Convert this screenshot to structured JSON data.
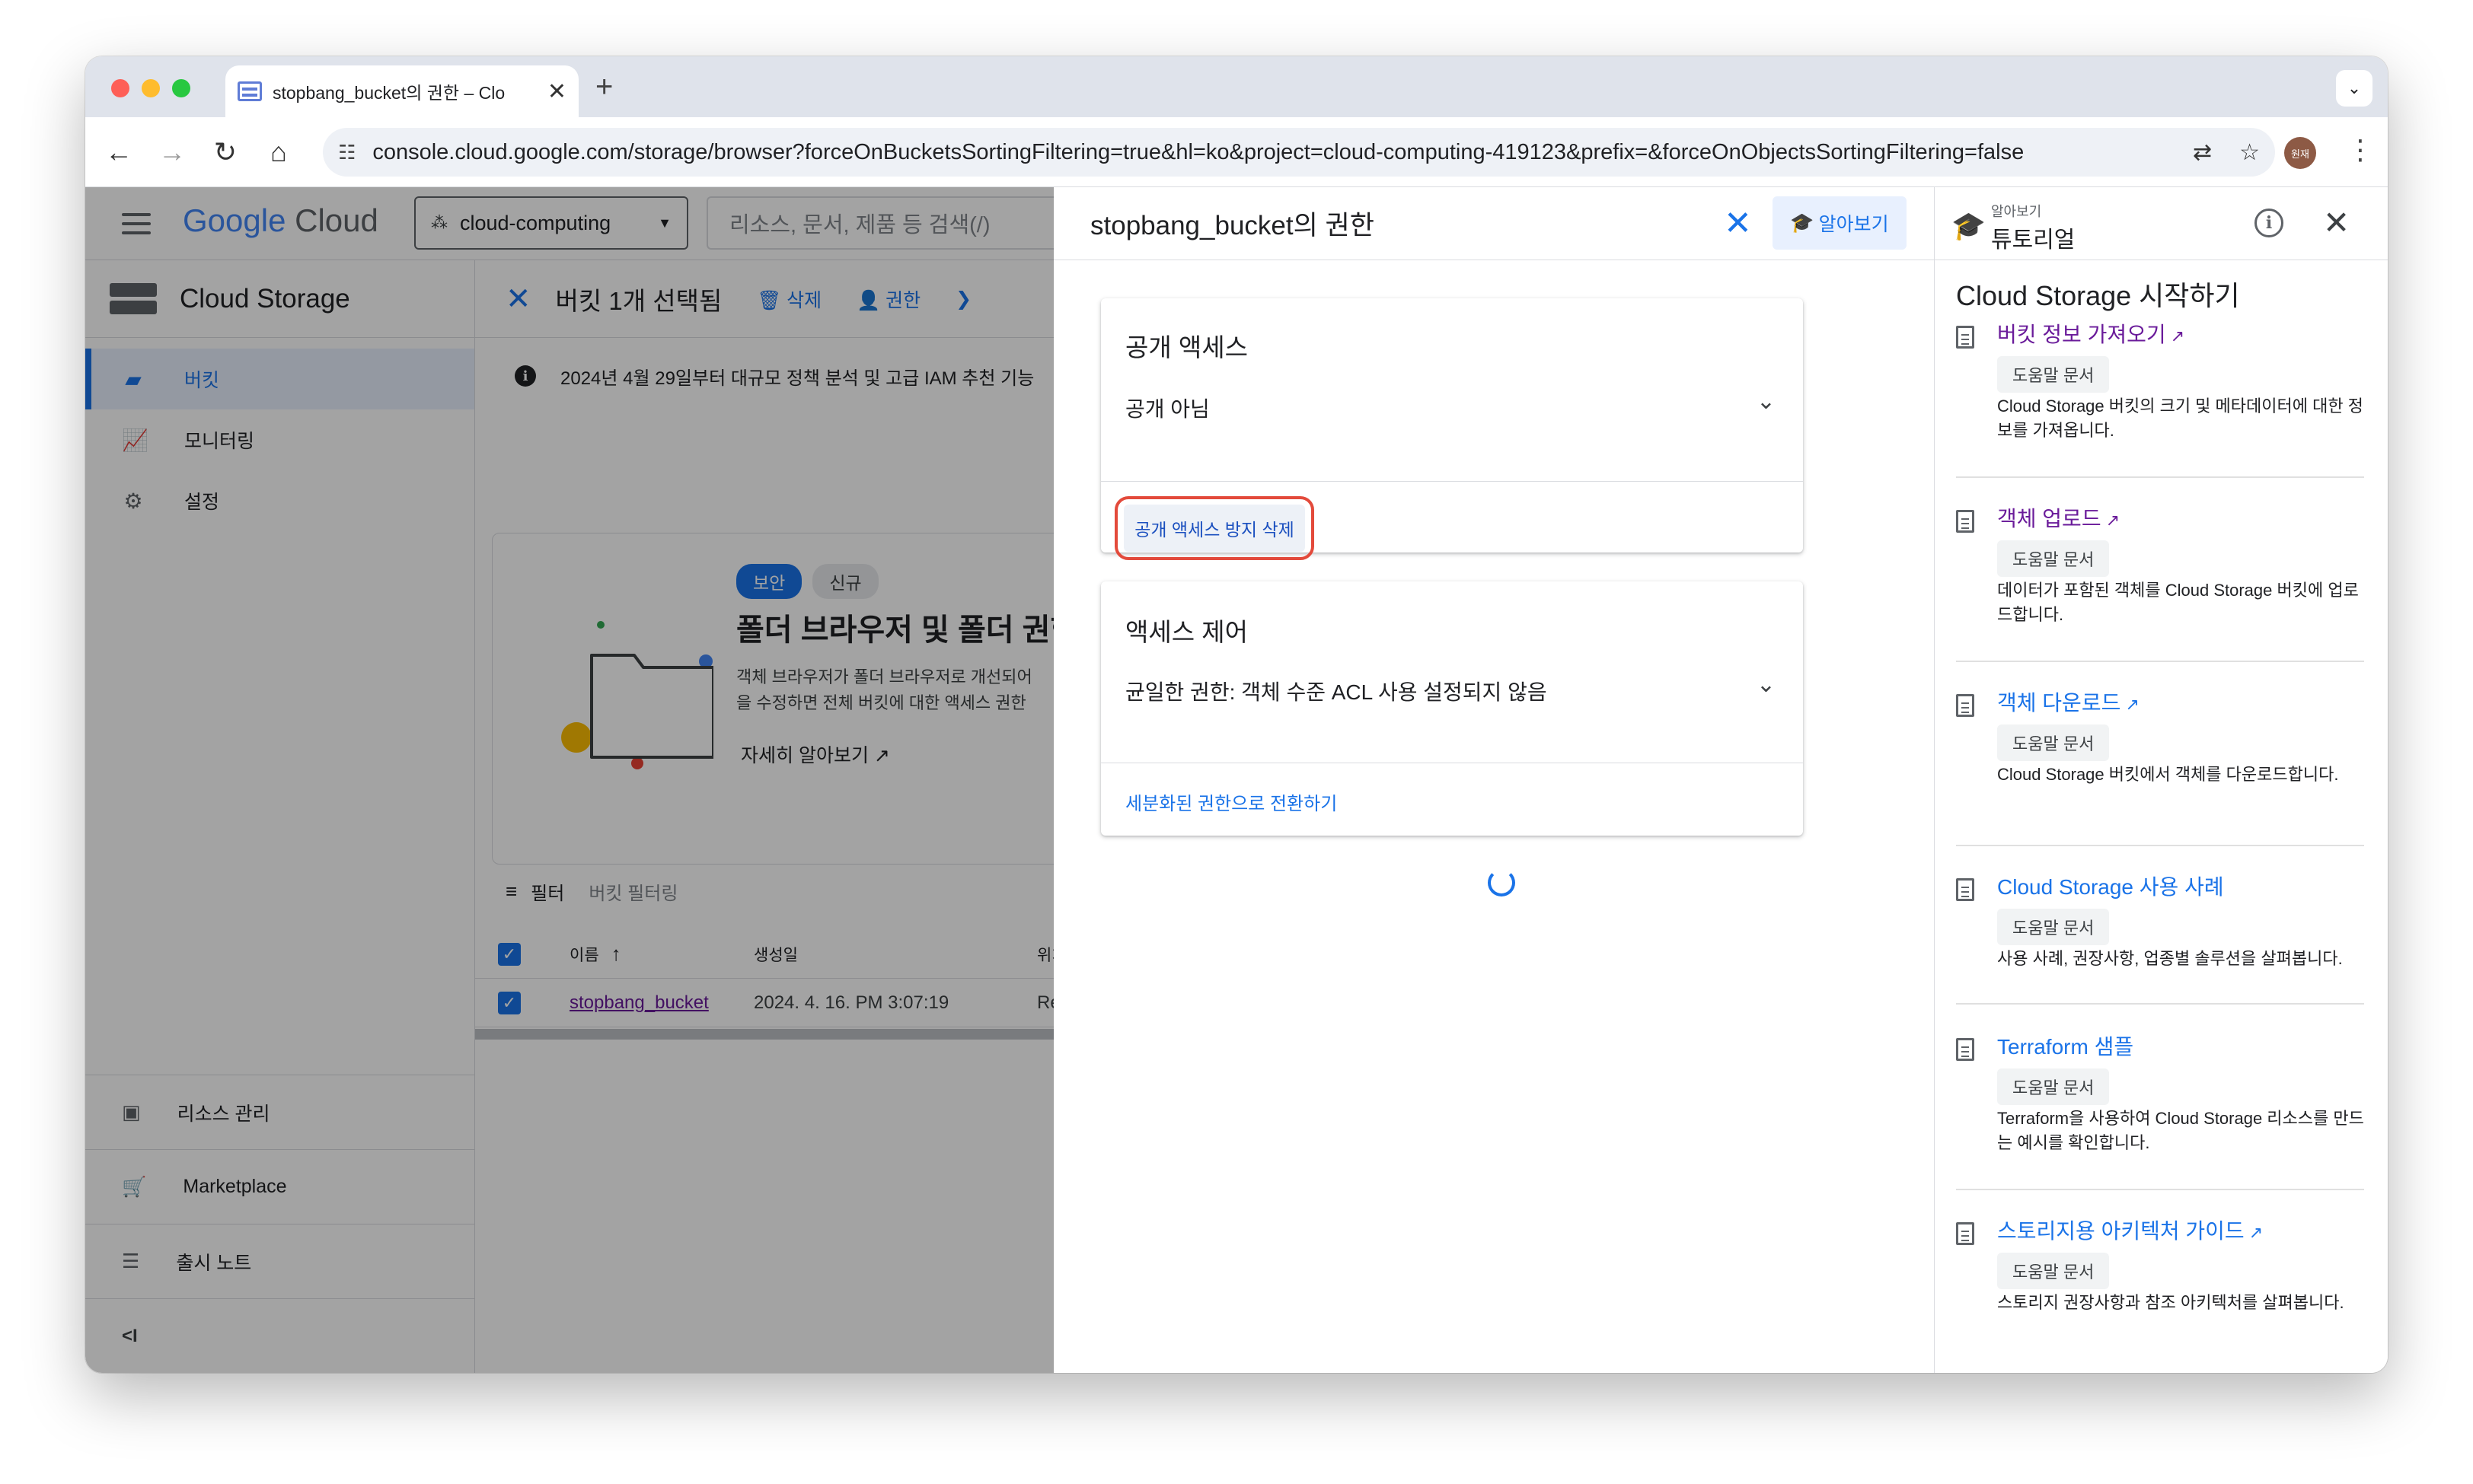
{
  "browser": {
    "tab_title": "stopbang_bucket의 권한 – Clo",
    "url": "console.cloud.google.com/storage/browser?forceOnBucketsSortingFiltering=true&hl=ko&project=cloud-computing-419123&prefix=&forceOnObjectsSortingFiltering=false",
    "profile_initials": "원재"
  },
  "console": {
    "logo_google": "Google",
    "logo_cloud": "Cloud",
    "project": "cloud-computing",
    "search_placeholder": "리소스, 문서, 제품 등 검색(/)"
  },
  "sidebar": {
    "product": "Cloud Storage",
    "items": [
      {
        "label": "버킷",
        "active": true
      },
      {
        "label": "모니터링"
      },
      {
        "label": "설정"
      }
    ],
    "bottom": [
      {
        "label": "리소스 관리"
      },
      {
        "label": "Marketplace"
      },
      {
        "label": "출시 노트"
      }
    ]
  },
  "main": {
    "selection": "버킷 1개 선택됨",
    "actions": [
      "삭제",
      "권한"
    ],
    "banner": "2024년 4월 29일부터 대규모 정책 분석 및 고급 IAM 추천 기능",
    "promo": {
      "chip_security": "보안",
      "chip_new": "신규",
      "title": "폴더 브라우저 및 폴더 권한",
      "desc_line1": "객체 브라우저가 폴더 브라우저로 개선되어",
      "desc_line2": "을 수정하면 전체 버킷에 대한 액세스 권한",
      "learn_more": "자세히 알아보기"
    },
    "filter_label": "필터",
    "filter_placeholder": "버킷 필터링",
    "columns": [
      "이름",
      "생성일",
      "위치"
    ],
    "row": {
      "name": "stopbang_bucket",
      "created": "2024. 4. 16. PM 3:07:19",
      "location": "Re"
    }
  },
  "dialog": {
    "title": "stopbang_bucket의 권한",
    "learn_button": "알아보기",
    "public_access": {
      "heading": "공개 액세스",
      "value": "공개 아님",
      "remove_button": "공개 액세스 방지 삭제"
    },
    "access_control": {
      "heading": "액세스 제어",
      "value": "균일한 권한: 객체 수준 ACL 사용 설정되지 않음",
      "link": "세분화된 권한으로 전환하기"
    }
  },
  "tutorial": {
    "caption": "알아보기",
    "title": "튜토리얼",
    "section_title": "Cloud Storage 시작하기",
    "tag_label": "도움말 문서",
    "items": [
      {
        "title": "버킷 정보 가져오기",
        "desc": "Cloud Storage 버킷의 크기 및 메타데이터에 대한 정보를 가져옵니다.",
        "color": "#6a1b9a",
        "external": true
      },
      {
        "title": "객체 업로드",
        "desc": "데이터가 포함된 객체를 Cloud Storage 버킷에 업로드합니다.",
        "color": "#6a1b9a",
        "external": true
      },
      {
        "title": "객체 다운로드",
        "desc": "Cloud Storage 버킷에서 객체를 다운로드합니다.",
        "color": "#1a73e8",
        "external": true
      },
      {
        "title": "Cloud Storage 사용 사례",
        "desc": "사용 사례, 권장사항, 업종별 솔루션을 살펴봅니다.",
        "color": "#1a73e8",
        "external": false
      },
      {
        "title": "Terraform 샘플",
        "desc": "Terraform을 사용하여 Cloud Storage 리소스를 만드는 예시를 확인합니다.",
        "color": "#1a73e8",
        "external": false
      },
      {
        "title": "스토리지용 아키텍처 가이드",
        "desc": "스토리지 권장사항과 참조 아키텍처를 살펴봅니다.",
        "color": "#1a73e8",
        "external": true
      }
    ]
  },
  "colors": {
    "accent": "#1a73e8",
    "highlight": "#e34a3b"
  }
}
